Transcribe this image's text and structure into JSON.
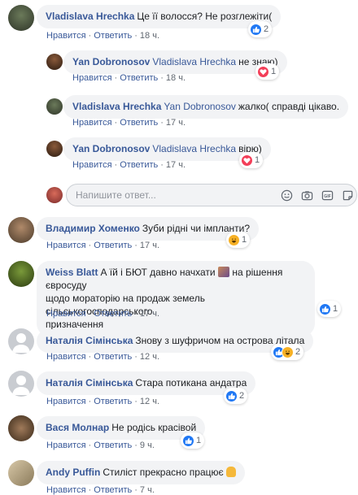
{
  "ui": {
    "like_label": "Нравится",
    "reply_label": "Ответить",
    "dot": "·"
  },
  "comments": [
    {
      "author": "Vladislava Hrechka",
      "mention": "",
      "text": "Це її волосся? Не розглежіти(",
      "time": "18 ч.",
      "reaction_count": "2"
    },
    {
      "author": "Yan Dobronosov",
      "mention": "Vladislava Hrechka",
      "text": "не знаю)",
      "time": "18 ч.",
      "reaction_count": "1"
    },
    {
      "author": "Vladislava Hrechka",
      "mention": "Yan Dobronosov",
      "text": "жалко( справді цікаво.",
      "time": "17 ч.",
      "reaction_count": ""
    },
    {
      "author": "Yan Dobronosov",
      "mention": "Vladislava Hrechka",
      "text": "вірю)",
      "time": "17 ч.",
      "reaction_count": "1"
    },
    {
      "author": "Владимир Хоменко",
      "mention": "",
      "text": "Зуби рідні чи імпланти?",
      "time": "17 ч.",
      "reaction_count": "1"
    },
    {
      "author": "Weiss Blatt",
      "mention": "",
      "text_a": "А їй і БЮТ давно начхати",
      "text_b": "на рішення євросуду",
      "text_c": "щодо мораторію на продаж земель сільськогосподарського",
      "text_d": "призначення",
      "time": "17 ч.",
      "reaction_count": "1"
    },
    {
      "author": "Наталія Сімінська",
      "mention": "",
      "text": "Знову з шуфричом на острова літала",
      "time": "12 ч.",
      "reaction_count": "2"
    },
    {
      "author": "Наталія Сімінська",
      "mention": "",
      "text": "Стара потикана андатра",
      "time": "12 ч.",
      "reaction_count": "2"
    },
    {
      "author": "Вася Молнар",
      "mention": "",
      "text": "Не родісь красівой",
      "time": "9 ч.",
      "reaction_count": "1"
    },
    {
      "author": "Andy Puffin",
      "mention": "",
      "text": "Стиліст прекрасно працює",
      "time": "7 ч.",
      "reaction_count": ""
    }
  ],
  "reply_box": {
    "placeholder": "Напишите ответ..."
  },
  "colors": {
    "link": "#385898",
    "bubble": "#f2f3f5",
    "like": "#2078f4",
    "love": "#f33e58",
    "haha": "#f7b125"
  }
}
